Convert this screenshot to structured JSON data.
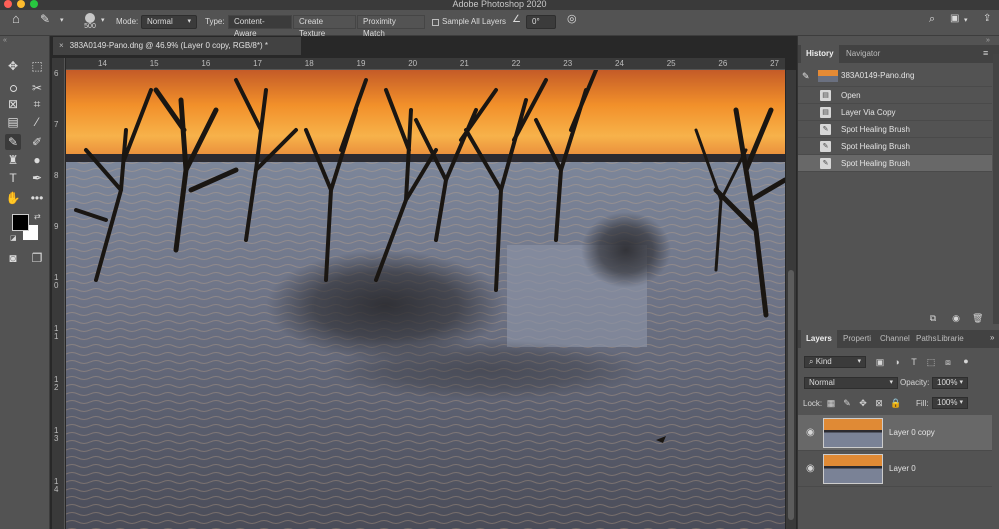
{
  "window": {
    "title": "Adobe Photoshop 2020"
  },
  "options_bar": {
    "brush_size": "500",
    "mode_label": "Mode:",
    "mode_value": "Normal",
    "type_label": "Type:",
    "type_options": [
      "Content-Aware",
      "Create Texture",
      "Proximity Match"
    ],
    "sample_all_layers": "Sample All Layers",
    "angle_value": "0°"
  },
  "document": {
    "tab_title": "383A0149-Pano.dng @ 46.9% (Layer 0 copy, RGB/8*) *",
    "ruler_top": [
      "14",
      "15",
      "16",
      "17",
      "18",
      "19",
      "20",
      "21",
      "22",
      "23",
      "24",
      "25",
      "26",
      "27"
    ],
    "ruler_left": [
      "6",
      "7",
      "8",
      "9",
      "1\n0",
      "1\n1",
      "1\n2",
      "1\n3",
      "1\n4"
    ]
  },
  "history_panel": {
    "tabs": [
      "History",
      "Navigator"
    ],
    "snapshot": "383A0149-Pano.dng",
    "steps": [
      "Open",
      "Layer Via Copy",
      "Spot Healing Brush",
      "Spot Healing Brush",
      "Spot Healing Brush"
    ]
  },
  "layers_panel": {
    "tabs": [
      "Layers",
      "Properti",
      "Channel",
      "Paths",
      "Librarie"
    ],
    "filter_kind": "Kind",
    "blend_mode": "Normal",
    "opacity_label": "Opacity:",
    "opacity_value": "100%",
    "lock_label": "Lock:",
    "fill_label": "Fill:",
    "fill_value": "100%",
    "layers": [
      {
        "name": "Layer 0 copy",
        "selected": true
      },
      {
        "name": "Layer 0",
        "selected": false
      }
    ]
  },
  "colors": {
    "accent_close": "#fe5f57",
    "accent_min": "#febc2e",
    "accent_max": "#28c840",
    "panel_bg": "#535353",
    "dark_bg": "#282828"
  }
}
